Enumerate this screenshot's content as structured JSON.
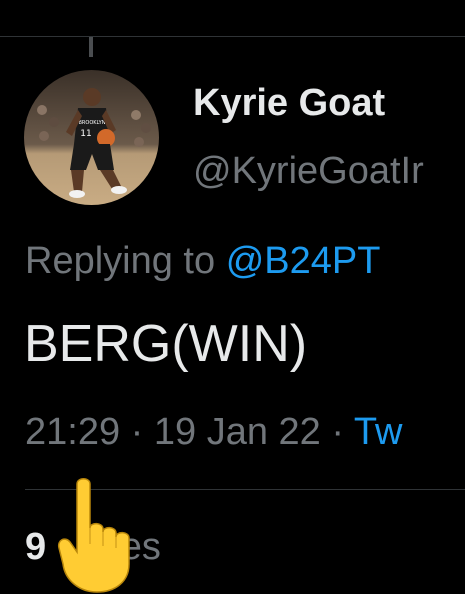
{
  "tweet": {
    "display_name": "Kyrie Goat",
    "handle": "@KyrieGoatIr",
    "replying_prefix": "Replying to",
    "replying_to": "@B24PT",
    "text": "BERG(WIN)",
    "time": "21:29",
    "separator": "·",
    "date": "19 Jan 22",
    "source": "Tw",
    "likes_count": "9",
    "likes_label": "es"
  },
  "avatar": {
    "icon": "basketball-player-avatar",
    "jersey_number": "11"
  },
  "overlay": {
    "icon": "pointing-hand-emoji-icon"
  },
  "colors": {
    "background": "#000000",
    "primary_text": "#e7e9ea",
    "secondary_text": "#71767b",
    "link": "#1d9bf0",
    "divider": "#2f3336",
    "emoji_yellow": "#ffcc33"
  }
}
